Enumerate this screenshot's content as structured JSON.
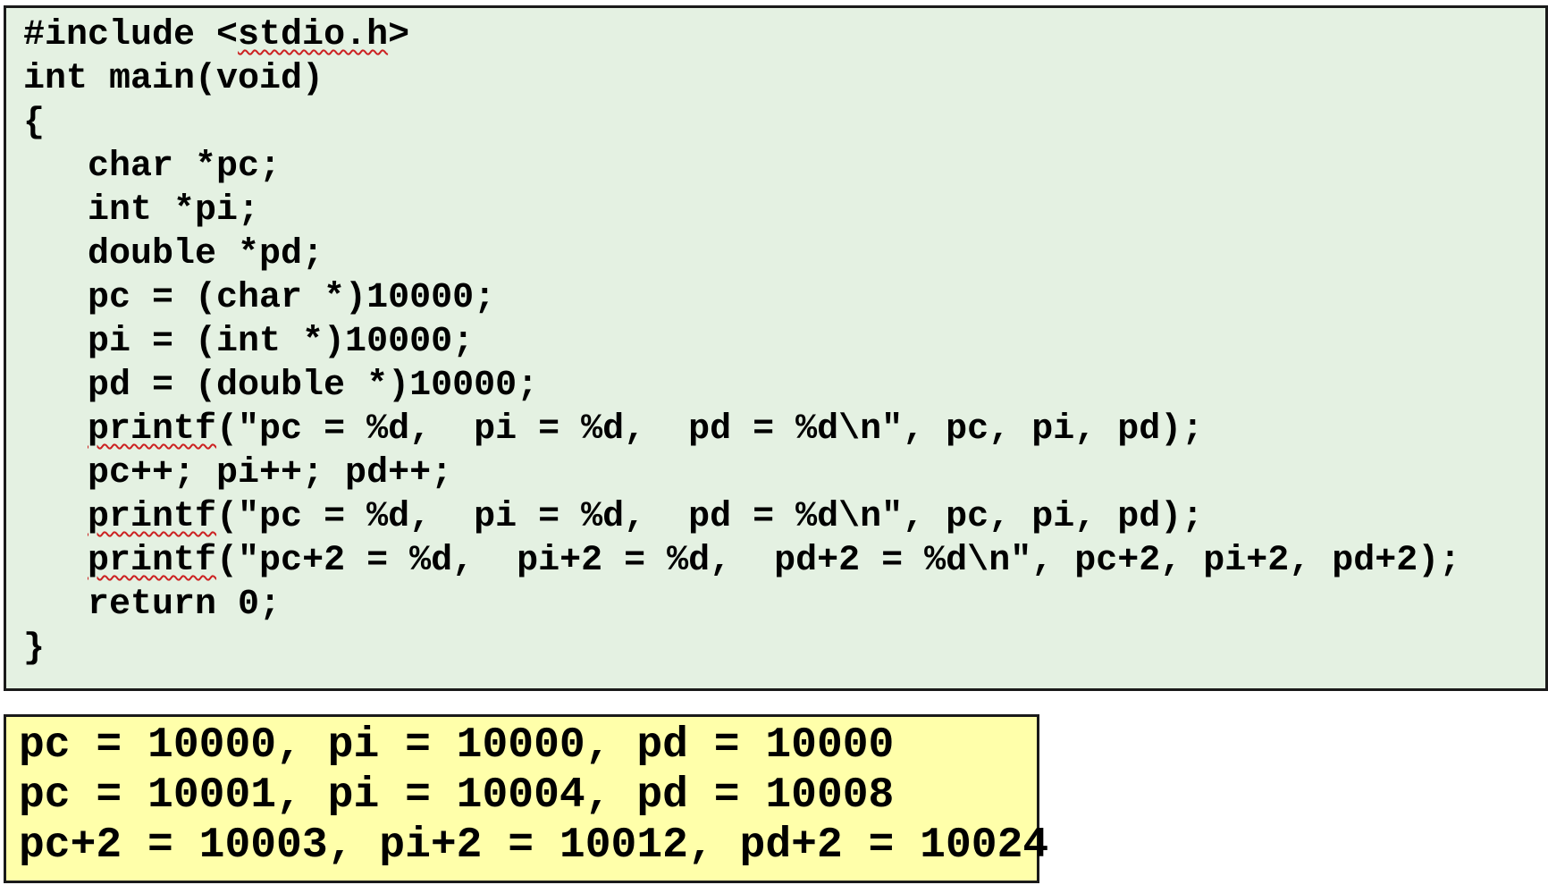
{
  "code": {
    "lines": [
      {
        "prefix": "#include <",
        "squiggle": "stdio.h",
        "suffix": ">"
      },
      {
        "prefix": "int main(void)",
        "squiggle": "",
        "suffix": ""
      },
      {
        "prefix": "{",
        "squiggle": "",
        "suffix": ""
      },
      {
        "prefix": "   char *pc;",
        "squiggle": "",
        "suffix": ""
      },
      {
        "prefix": "   int *pi;",
        "squiggle": "",
        "suffix": ""
      },
      {
        "prefix": "   double *pd;",
        "squiggle": "",
        "suffix": ""
      },
      {
        "prefix": "   pc = (char *)10000;",
        "squiggle": "",
        "suffix": ""
      },
      {
        "prefix": "   pi = (int *)10000;",
        "squiggle": "",
        "suffix": ""
      },
      {
        "prefix": "   pd = (double *)10000;",
        "squiggle": "",
        "suffix": ""
      },
      {
        "prefix": "   ",
        "squiggle": "printf",
        "suffix": "(\"pc = %d,  pi = %d,  pd = %d\\n\", pc, pi, pd);"
      },
      {
        "prefix": "   pc++; pi++; pd++;",
        "squiggle": "",
        "suffix": ""
      },
      {
        "prefix": "   ",
        "squiggle": "printf",
        "suffix": "(\"pc = %d,  pi = %d,  pd = %d\\n\", pc, pi, pd);"
      },
      {
        "prefix": "   ",
        "squiggle": "printf",
        "suffix": "(\"pc+2 = %d,  pi+2 = %d,  pd+2 = %d\\n\", pc+2, pi+2, pd+2);"
      },
      {
        "prefix": "   return 0;",
        "squiggle": "",
        "suffix": ""
      },
      {
        "prefix": "}",
        "squiggle": "",
        "suffix": ""
      }
    ]
  },
  "output": {
    "lines": [
      "pc = 10000, pi = 10000, pd = 10000",
      "pc = 10001, pi = 10004, pd = 10008",
      "pc+2 = 10003, pi+2 = 10012, pd+2 = 10024"
    ]
  },
  "colors": {
    "code_background": "#e4f1e2",
    "output_background": "#ffffaa",
    "squiggle": "#cc2222"
  }
}
